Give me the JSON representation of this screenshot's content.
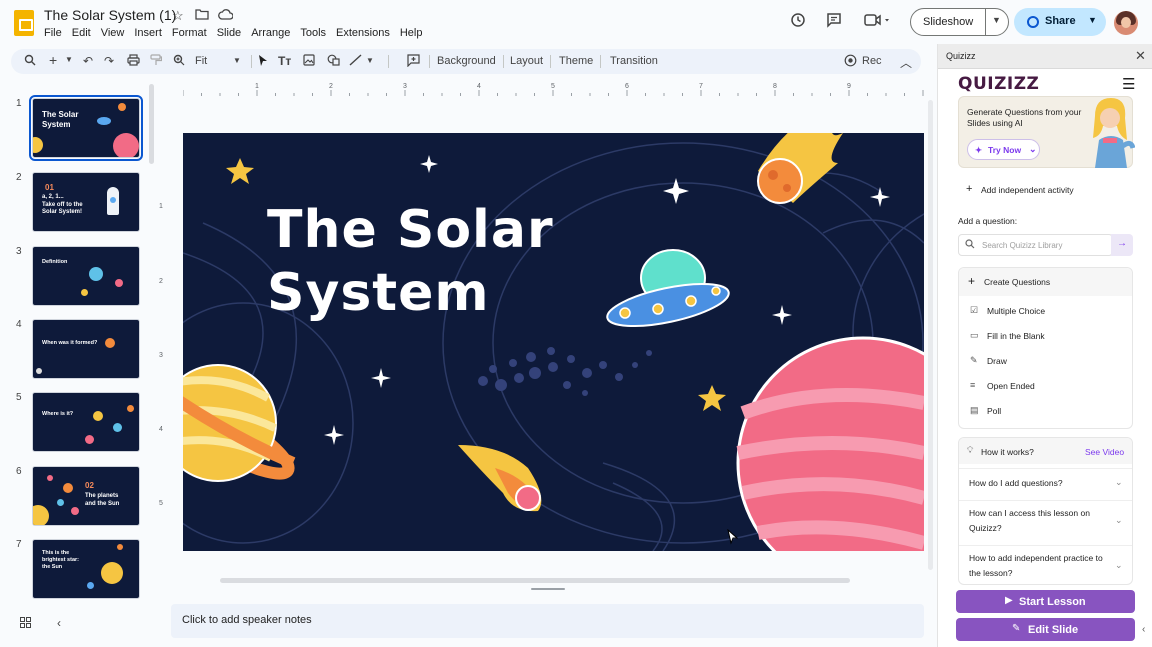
{
  "header": {
    "doc_title": "The Solar System (1)",
    "menu": [
      "File",
      "Edit",
      "View",
      "Insert",
      "Format",
      "Slide",
      "Arrange",
      "Tools",
      "Extensions",
      "Help"
    ],
    "slideshow_label": "Slideshow",
    "share_label": "Share"
  },
  "toolbar": {
    "zoom_value": "Fit",
    "background_label": "Background",
    "layout_label": "Layout",
    "theme_label": "Theme",
    "transition_label": "Transition",
    "rec_label": "Rec"
  },
  "filmstrip": {
    "slides": [
      {
        "num": "1",
        "text": "The Solar\nSystem",
        "accent": ""
      },
      {
        "num": "2",
        "text": "a, 2, 1...\nTake off to the\nSolar System!",
        "accent": "01"
      },
      {
        "num": "3",
        "text": "Definition",
        "accent": ""
      },
      {
        "num": "4",
        "text": "When was it formed?",
        "accent": ""
      },
      {
        "num": "5",
        "text": "Where is it?",
        "accent": ""
      },
      {
        "num": "6",
        "text": "The planets\nand the Sun",
        "accent": "02"
      },
      {
        "num": "7",
        "text": "This is the\nbrightest star:\nthe Sun",
        "accent": ""
      }
    ]
  },
  "rulers": {
    "top": [
      "1",
      "2",
      "3",
      "4",
      "5",
      "6",
      "7",
      "8",
      "9"
    ],
    "left": [
      "1",
      "2",
      "3",
      "4",
      "5"
    ]
  },
  "slide": {
    "title": "The Solar\nSystem",
    "bg_color": "#0e1a3a"
  },
  "notes_placeholder": "Click to add speaker notes",
  "quizizz": {
    "panel_title": "Quizizz",
    "logo": "QUIZIZZ",
    "promo_text": "Generate Questions from your Slides using AI",
    "try_now_label": "Try Now",
    "add_activity_label": "Add independent activity",
    "add_question_label": "Add a question:",
    "search_placeholder": "Search Quizizz Library",
    "create_questions_label": "Create Questions",
    "question_types": [
      {
        "label": "Multiple Choice",
        "icon": "checkbox-icon"
      },
      {
        "label": "Fill in the Blank",
        "icon": "blank-box-icon"
      },
      {
        "label": "Draw",
        "icon": "draw-icon"
      },
      {
        "label": "Open Ended",
        "icon": "lines-icon"
      },
      {
        "label": "Poll",
        "icon": "poll-icon"
      }
    ],
    "how_it_works_label": "How it works?",
    "see_video_label": "See Video",
    "faqs": [
      "How do I add questions?",
      "How can I access this lesson on Quizizz?",
      "How to add independent practice to the lesson?"
    ],
    "start_lesson_label": "Start Lesson",
    "edit_slide_label": "Edit Slide",
    "accent_color": "#8854c0"
  }
}
